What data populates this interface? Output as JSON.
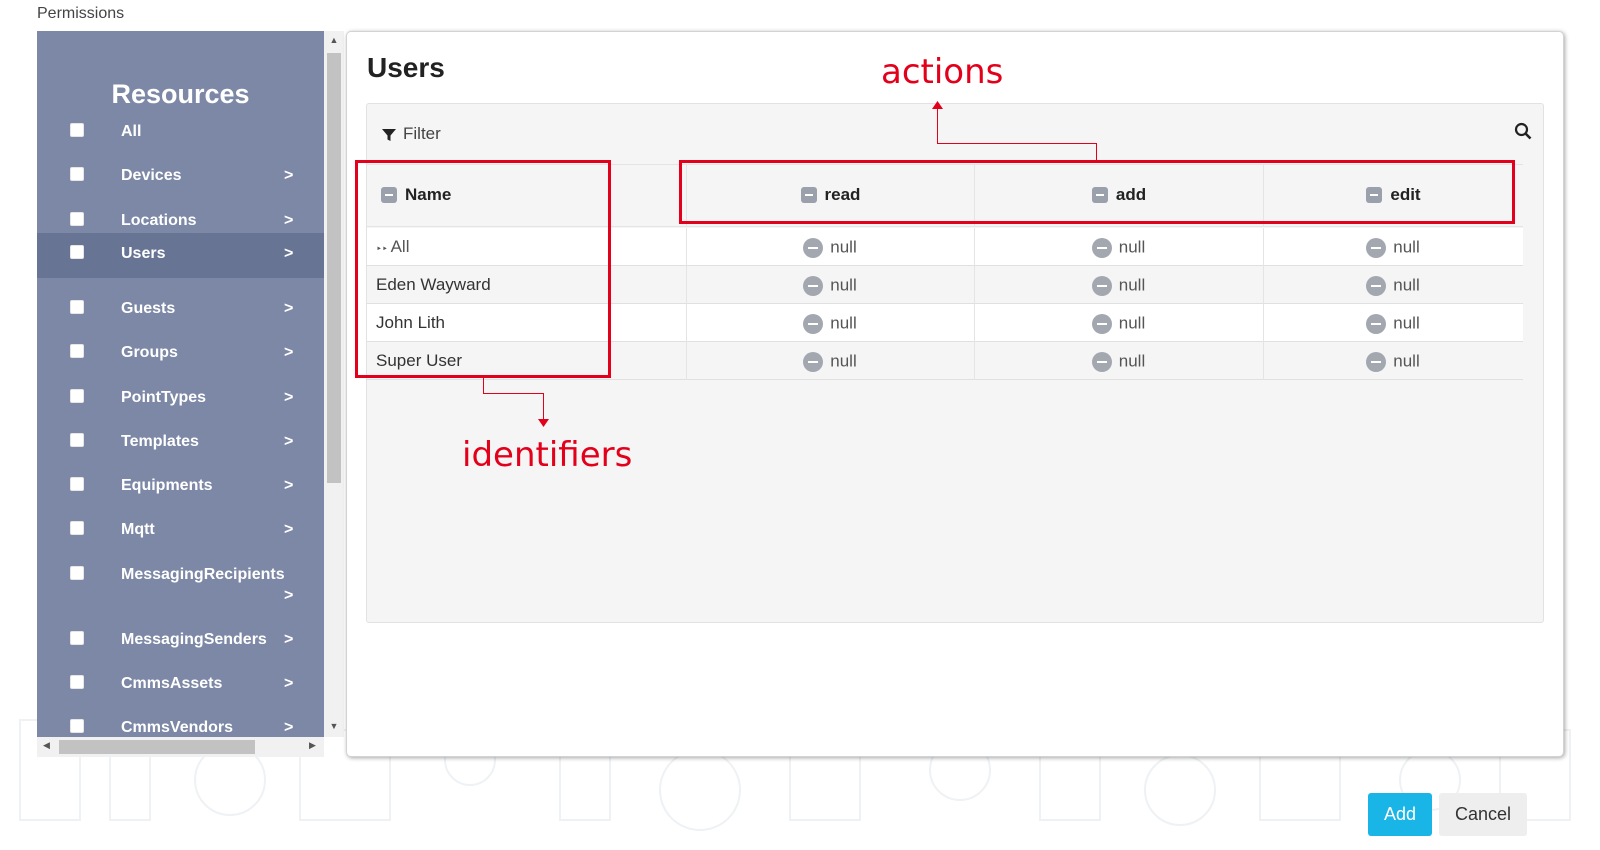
{
  "window": {
    "title": "Permissions"
  },
  "sidebar": {
    "title": "Resources",
    "items": [
      {
        "label": "All",
        "has_children": false
      },
      {
        "label": "Devices",
        "has_children": true
      },
      {
        "label": "Locations",
        "has_children": true
      },
      {
        "label": "Users",
        "has_children": true,
        "active": true
      },
      {
        "label": "Guests",
        "has_children": true
      },
      {
        "label": "Groups",
        "has_children": true
      },
      {
        "label": "PointTypes",
        "has_children": true
      },
      {
        "label": "Templates",
        "has_children": true
      },
      {
        "label": "Equipments",
        "has_children": true
      },
      {
        "label": "Mqtt",
        "has_children": true
      },
      {
        "label": "MessagingRecipients",
        "has_children": true
      },
      {
        "label": "MessagingSenders",
        "has_children": true
      },
      {
        "label": "CmmsAssets",
        "has_children": true
      },
      {
        "label": "CmmsVendors",
        "has_children": true
      }
    ],
    "chevron": ">"
  },
  "panel": {
    "title": "Users",
    "filter_label": "Filter",
    "columns": {
      "name": "Name",
      "actions": [
        "read",
        "add",
        "edit"
      ]
    },
    "rows": [
      {
        "name": "All",
        "is_all": true,
        "values": [
          "null",
          "null",
          "null"
        ]
      },
      {
        "name": "Eden Wayward",
        "values": [
          "null",
          "null",
          "null"
        ]
      },
      {
        "name": "John Lith",
        "values": [
          "null",
          "null",
          "null"
        ]
      },
      {
        "name": "Super User",
        "values": [
          "null",
          "null",
          "null"
        ]
      }
    ]
  },
  "annotations": {
    "actions": "actions",
    "identifiers": "identifiers"
  },
  "buttons": {
    "add": "Add",
    "cancel": "Cancel"
  },
  "colors": {
    "sidebar_bg": "#7c88a6",
    "sidebar_active": "#677494",
    "annotation_red": "#e3001b",
    "primary_button": "#19b5e6"
  },
  "icons": {
    "filter": "funnel-icon",
    "search": "search-icon",
    "checkbox": "checkbox-icon",
    "null_state": "minus-circle-icon"
  }
}
